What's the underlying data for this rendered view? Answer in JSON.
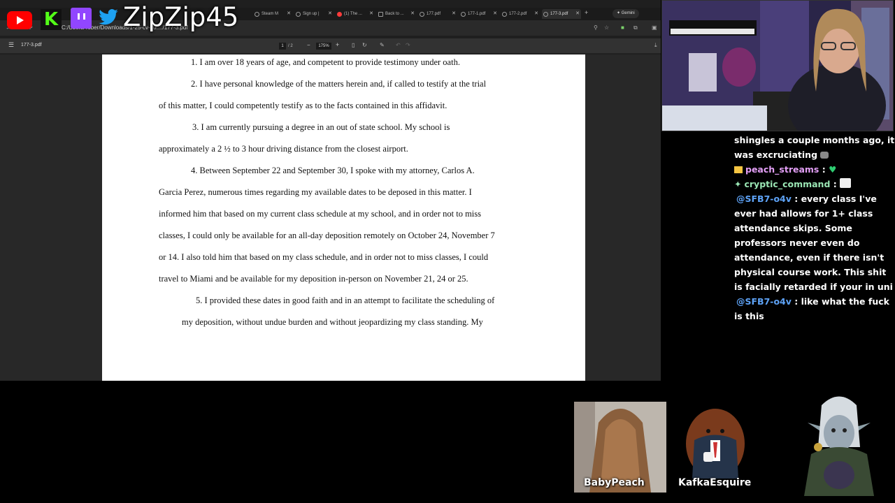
{
  "browser": {
    "tabs": [
      {
        "label": "Steam M"
      },
      {
        "label": "Sign up |"
      },
      {
        "label": "(1) The ..."
      },
      {
        "label": "Back to ..."
      },
      {
        "label": "177.pdf"
      },
      {
        "label": "177-1.pdf"
      },
      {
        "label": "177-2.pdf"
      },
      {
        "label": "177-3.pdf"
      }
    ],
    "new_tab_symbol": "+",
    "gemini_label": "Gemini",
    "url": "C:/Users/Tober/Downloads/1-25-cv-20..../177-3.pdf"
  },
  "pdf": {
    "title": "177-3.pdf",
    "current_page": "1",
    "page_total": "/  2",
    "zoom": "175%",
    "zoom_out": "−",
    "zoom_in": "+"
  },
  "document": {
    "lines": [
      "1.       I am over 18 years of age, and competent to provide testimony under oath.",
      "2.       I have personal knowledge of the matters herein and, if called to testify at the trial",
      "of this matter, I could competently testify as to the facts contained in this affidavit.",
      "3.       I  am currently pursuing a degree in an out of state school.  My school is",
      "approximately a 2 ½ to 3 hour driving distance from the closest airport.",
      "4.       Between September 22 and September 30, I spoke with my attorney, Carlos A.",
      "Garcia  Perez, numerous times regarding my  available dates to be deposed in this matter. I",
      "informed him that based on my current class schedule at my school, and in order not to miss",
      "classes, I could only be available for an all-day deposition remotely on October 24, November 7",
      "or 14. I also told him that based on my class schedule, and in order not to miss classes, I could",
      "travel to Miami and be available for my deposition in-person on November 21, 24 or 25.",
      "5.       I provided these dates in good faith and in an attempt to facilitate the scheduling of",
      "my deposition, without undue burden and without jeopardizing my class standing. My"
    ]
  },
  "overlay": {
    "handle": "ZipZip45"
  },
  "chat": {
    "messages": [
      {
        "user": "",
        "text": "shingles a couple months ago, it was excruciating",
        "user_color": "#ffffff"
      },
      {
        "user": "peach_streams",
        "text": " :",
        "user_color": "#e39ff6"
      },
      {
        "user": "cryptic_command",
        "text": " :",
        "user_color": "#9ae6b4"
      },
      {
        "user": "@SFB7-o4v",
        "text": " : every class I've ever had allows for 1+ class attendance skips. Some professors never even do attendance, even if there isn't physical course work. This shit is facially retarded if your in uni",
        "user_color": "#5ea3f7"
      },
      {
        "user": "@SFB7-o4v",
        "text": " : like what the fuck is this",
        "user_color": "#5ea3f7"
      }
    ]
  },
  "avatars": [
    {
      "name": "BabyPeach"
    },
    {
      "name": "KafkaEsquire"
    }
  ],
  "colors": {
    "youtube": "#ff0000",
    "kick": "#53fc18",
    "twitch": "#9146ff",
    "twitter": "#1da1f2",
    "heart": "#2ecc71"
  }
}
